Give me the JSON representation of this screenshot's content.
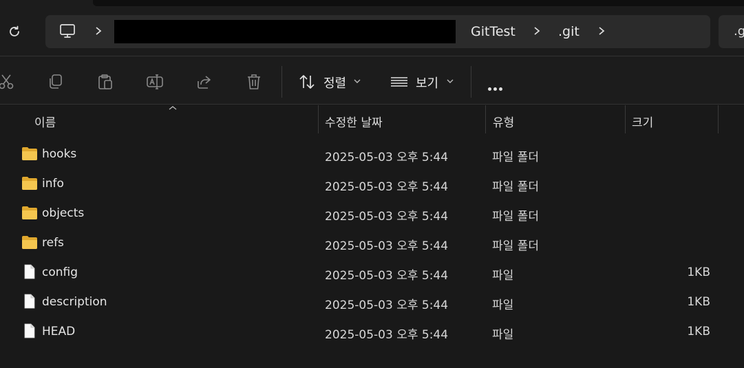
{
  "address_bar": {
    "crumbs": [
      "GitTest",
      ".git"
    ],
    "overflow_crumb": ".g"
  },
  "toolbar": {
    "sort_label": "정렬",
    "view_label": "보기",
    "icons": [
      "cut-icon",
      "copy-icon",
      "paste-icon",
      "rename-icon",
      "share-icon",
      "delete-icon",
      "sort-icon",
      "view-icon",
      "more-icon"
    ]
  },
  "columns": {
    "name": "이름",
    "modified": "수정한 날짜",
    "type": "유형",
    "size": "크기"
  },
  "files": [
    {
      "name": "hooks",
      "modified": "2025-05-03 오후 5:44",
      "type": "파일 폴더",
      "size": "",
      "kind": "folder"
    },
    {
      "name": "info",
      "modified": "2025-05-03 오후 5:44",
      "type": "파일 폴더",
      "size": "",
      "kind": "folder"
    },
    {
      "name": "objects",
      "modified": "2025-05-03 오후 5:44",
      "type": "파일 폴더",
      "size": "",
      "kind": "folder"
    },
    {
      "name": "refs",
      "modified": "2025-05-03 오후 5:44",
      "type": "파일 폴더",
      "size": "",
      "kind": "folder"
    },
    {
      "name": "config",
      "modified": "2025-05-03 오후 5:44",
      "type": "파일",
      "size": "1KB",
      "kind": "file"
    },
    {
      "name": "description",
      "modified": "2025-05-03 오후 5:44",
      "type": "파일",
      "size": "1KB",
      "kind": "file"
    },
    {
      "name": "HEAD",
      "modified": "2025-05-03 오후 5:44",
      "type": "파일",
      "size": "1KB",
      "kind": "file"
    }
  ],
  "colors": {
    "background": "#191919",
    "folder": "#f4c64f",
    "address_bar": "#2b2b2b"
  }
}
